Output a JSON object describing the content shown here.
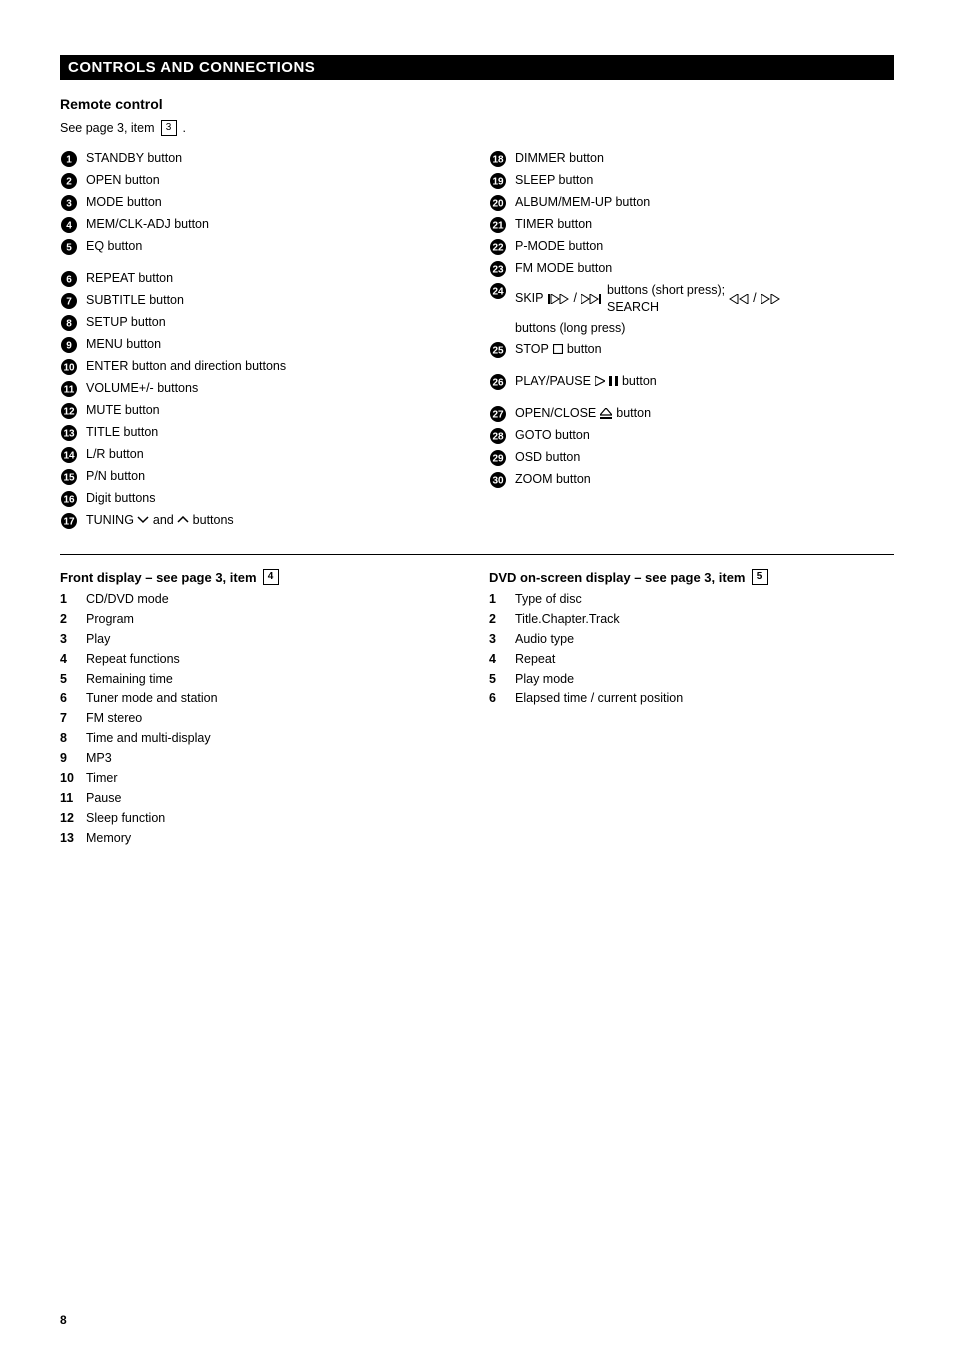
{
  "header": {
    "title": "CONTROLS AND CONNECTIONS"
  },
  "remote": {
    "section_title": "Remote control",
    "see_page_label": "See page 3, item",
    "figref": "3",
    "period": ".",
    "left": [
      {
        "n": "1",
        "text": "STANDBY button"
      },
      {
        "n": "2",
        "text": "OPEN button"
      },
      {
        "n": "3",
        "text": "MODE button"
      },
      {
        "n": "4",
        "text": "MEM/CLK-ADJ button"
      },
      {
        "n": "5",
        "text": "EQ button"
      },
      {
        "n": "_spacer"
      },
      {
        "n": "6",
        "text": "REPEAT button"
      },
      {
        "n": "7",
        "text": "SUBTITLE button"
      },
      {
        "n": "8",
        "text": "SETUP button"
      },
      {
        "n": "9",
        "text": "MENU button"
      },
      {
        "n": "10",
        "text": "ENTER button and direction buttons"
      },
      {
        "n": "11",
        "text": "VOLUME+/- buttons"
      },
      {
        "n": "12",
        "text": "MUTE button"
      },
      {
        "n": "13",
        "text": "TITLE button"
      },
      {
        "n": "14",
        "text": "L/R button"
      },
      {
        "n": "15",
        "text": "P/N button"
      },
      {
        "n": "16",
        "text": "Digit buttons"
      },
      {
        "n": "17",
        "text": "TUNING      and      buttons"
      }
    ],
    "right": [
      {
        "n": "18",
        "text": "DIMMER button"
      },
      {
        "n": "19",
        "text": "SLEEP button"
      },
      {
        "n": "20",
        "text": "ALBUM/MEM-UP button"
      },
      {
        "n": "21",
        "text": "TIMER button"
      },
      {
        "n": "22",
        "text": "P-MODE button"
      },
      {
        "n": "23",
        "text": "FM MODE button"
      },
      {
        "n": "24",
        "text": "SKIP       /        buttons (short press); SEARCH       /        buttons (long press)",
        "transport": "skip"
      },
      {
        "n": "25",
        "text": "STOP       button",
        "transport": "stop"
      },
      {
        "n": "_spacer"
      },
      {
        "n": "26",
        "text": "PLAY/PAUSE            button",
        "transport": "playpause"
      },
      {
        "n": "_spacer"
      },
      {
        "n": "27",
        "text": "OPEN/CLOSE        button",
        "transport": "eject"
      },
      {
        "n": "28",
        "text": "GOTO button"
      },
      {
        "n": "29",
        "text": "OSD button"
      },
      {
        "n": "30",
        "text": "ZOOM button"
      }
    ]
  },
  "displays": {
    "front": {
      "heading_label": "Front display – see page 3, item",
      "figref": "4",
      "items": [
        {
          "n": "1",
          "text": "CD/DVD mode"
        },
        {
          "n": "2",
          "text": "Program"
        },
        {
          "n": "3",
          "text": "Play"
        },
        {
          "n": "4",
          "text": "Repeat functions"
        },
        {
          "n": "5",
          "text": "Remaining time"
        },
        {
          "n": "6",
          "text": "Tuner mode and station"
        },
        {
          "n": "7",
          "text": "FM stereo"
        },
        {
          "n": "8",
          "text": "Time and multi-display"
        },
        {
          "n": "9",
          "text": "MP3"
        },
        {
          "n": "10",
          "text": "Timer"
        },
        {
          "n": "11",
          "text": "Pause"
        },
        {
          "n": "12",
          "text": "Sleep function"
        },
        {
          "n": "13",
          "text": "Memory"
        }
      ]
    },
    "dvd": {
      "heading_label": "DVD on-screen display – see page 3, item",
      "figref": "5",
      "items": [
        {
          "n": "1",
          "text": "Type of disc"
        },
        {
          "n": "2",
          "text": "Title.Chapter.Track"
        },
        {
          "n": "3",
          "text": "Audio type"
        },
        {
          "n": "4",
          "text": "Repeat"
        },
        {
          "n": "5",
          "text": "Play mode"
        },
        {
          "n": "6",
          "text": "Elapsed time / current position"
        }
      ]
    }
  },
  "page_number": "8"
}
